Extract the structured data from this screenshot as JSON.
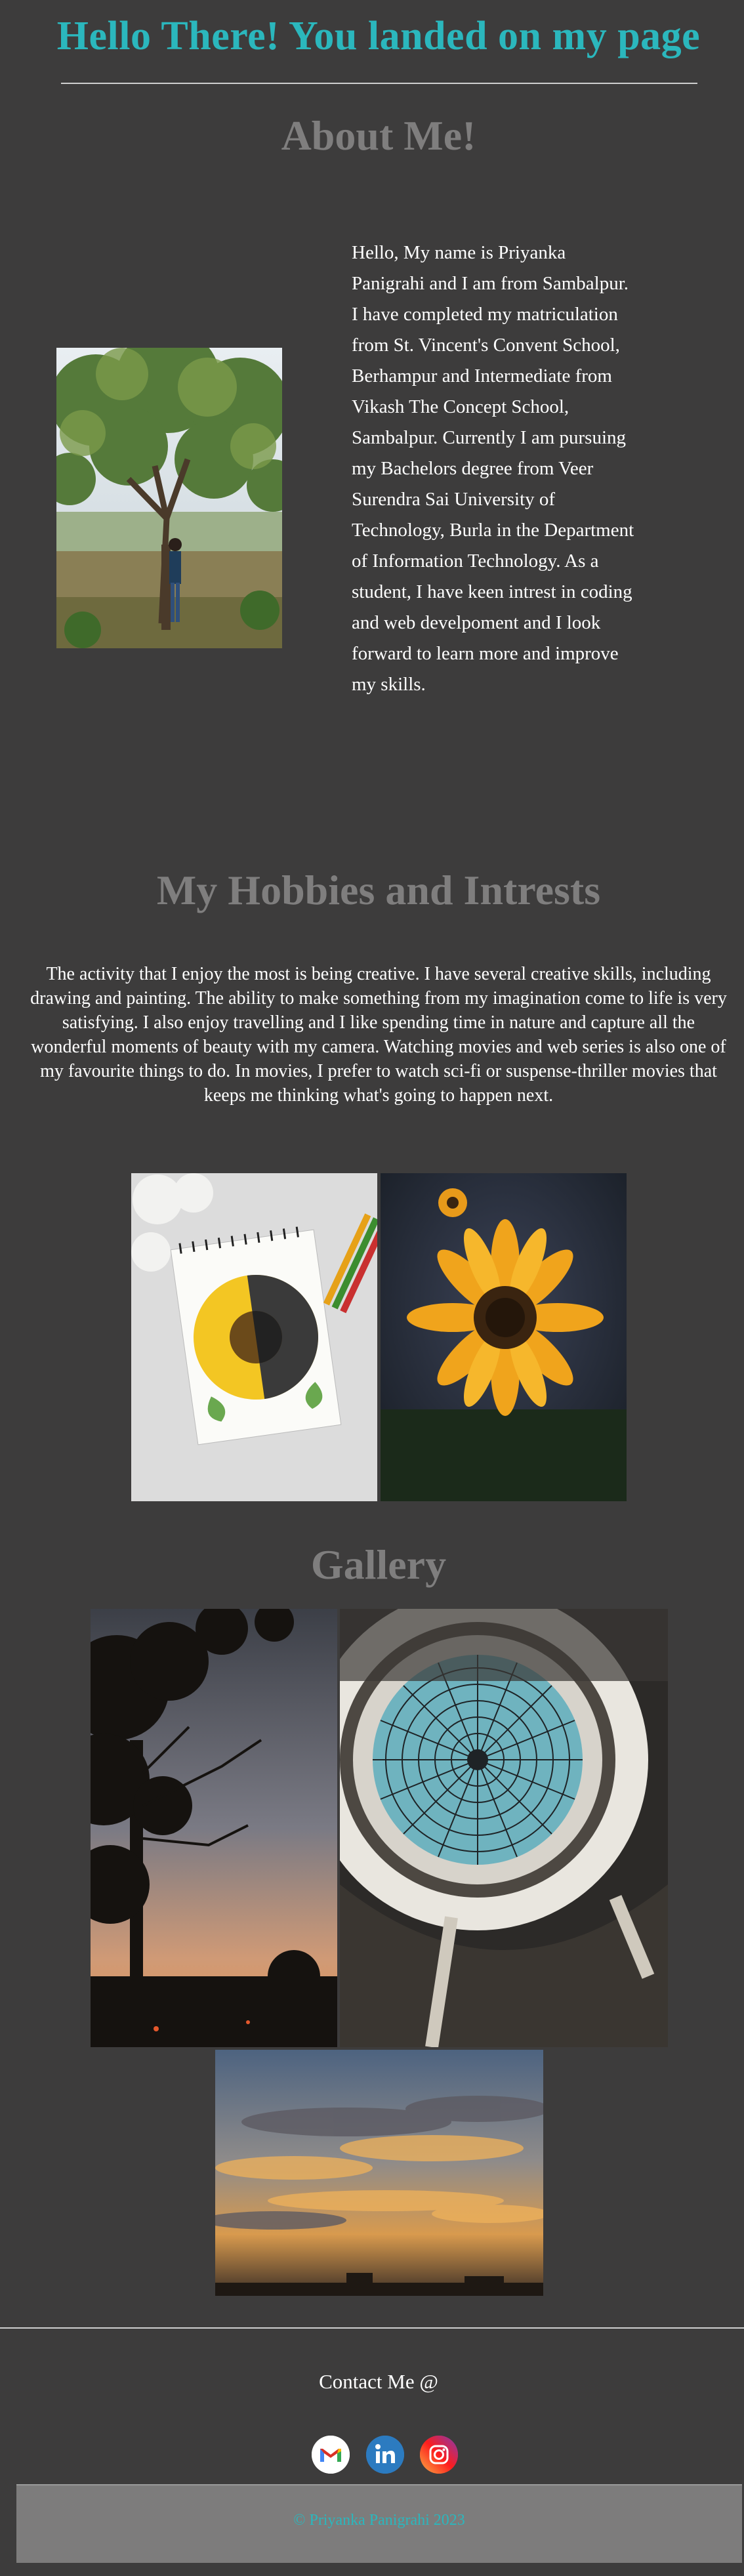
{
  "header": {
    "title": "Hello There! You landed on my page"
  },
  "about": {
    "heading": "About Me!",
    "paragraph": "Hello, My name is Priyanka Panigrahi and I am from Sambalpur. I have completed my matriculation from St. Vincent's Convent School, Berhampur and Intermediate from Vikash The Concept School, Sambalpur. Currently I am pursuing my Bachelors degree from Veer Surendra Sai University of Technology, Burla in the Department of Information Technology. As a student, I have keen intrest in coding and web develpoment and I look forward to learn more and improve my skills."
  },
  "hobbies": {
    "heading": "My Hobbies and Intrests",
    "paragraph": "The activity that I enjoy the most is being creative. I have several creative skills, including drawing and painting. The ability to make something from my imagination come to life is very satisfying. I also enjoy travelling and I like spending time in nature and capture all the wonderful moments of beauty with my camera. Watching movies and web series is also one of my favourite things to do. In movies, I prefer to watch sci-fi or suspense-thriller movies that keeps me thinking what's going to happen next."
  },
  "gallery": {
    "heading": "Gallery"
  },
  "footer": {
    "contact_label": "Contact Me @",
    "copyright": "© Priyanka Panigrahi 2023",
    "social_icons": [
      "gmail-icon",
      "linkedin-icon",
      "instagram-icon"
    ]
  },
  "colors": {
    "background": "#3d3c3c",
    "title_teal": "#2bb7bd",
    "heading_gray": "#7f7e7e",
    "footer_gray": "#7d7c7c"
  }
}
